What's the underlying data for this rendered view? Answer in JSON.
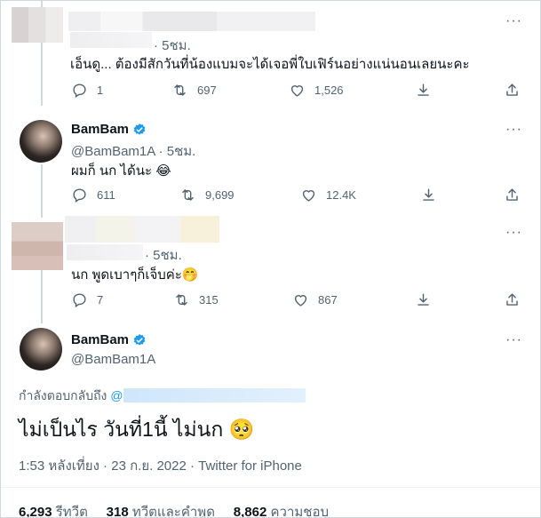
{
  "tweets": [
    {
      "handle_suffix": "· 5ชม.",
      "text": "เอ็นดู... ต้องมีสักวันที่น้องแบมจะได้เจอพี่ใบเฟิร์นอย่างแน่นอนเลยนะคะ",
      "replies": "1",
      "retweets": "697",
      "likes": "1,526"
    },
    {
      "name": "BamBam",
      "handle": "@BamBam1A",
      "time": "· 5ชม.",
      "text": "ผมก็ นก ได้นะ",
      "emoji": "😂",
      "replies": "611",
      "retweets": "9,699",
      "likes": "12.4K"
    },
    {
      "handle_suffix": "· 5ชม.",
      "text": "นก พูดเบาๆก็เจ็บค่ะ",
      "emoji": "🤭",
      "replies": "7",
      "retweets": "315",
      "likes": "867"
    }
  ],
  "main_tweet": {
    "name": "BamBam",
    "handle": "@BamBam1A",
    "replying_to": "กำลังตอบกลับถึง",
    "mention_prefix": "@",
    "text": "ไม่เป็นไร วันที่1นี้ ไม่นก",
    "emoji": "🥺",
    "timestamp": "1:53 หลังเที่ยง · 23 ก.ย. 2022 · Twitter for iPhone",
    "retweets_count": "6,293",
    "retweets_label": "รีทวีต",
    "quotes_count": "318",
    "quotes_label": "ทวีตและคำพูด",
    "likes_count": "8,862",
    "likes_label": "ความชอบ"
  },
  "more_label": "···",
  "colors": {
    "accent": "#1d9bf0",
    "muted": "#536471",
    "text": "#0f1419",
    "divider": "#eff3f4"
  },
  "icons": [
    "reply-icon",
    "retweet-icon",
    "like-icon",
    "share-icon",
    "upload-icon",
    "verified-badge-icon",
    "more-icon"
  ]
}
